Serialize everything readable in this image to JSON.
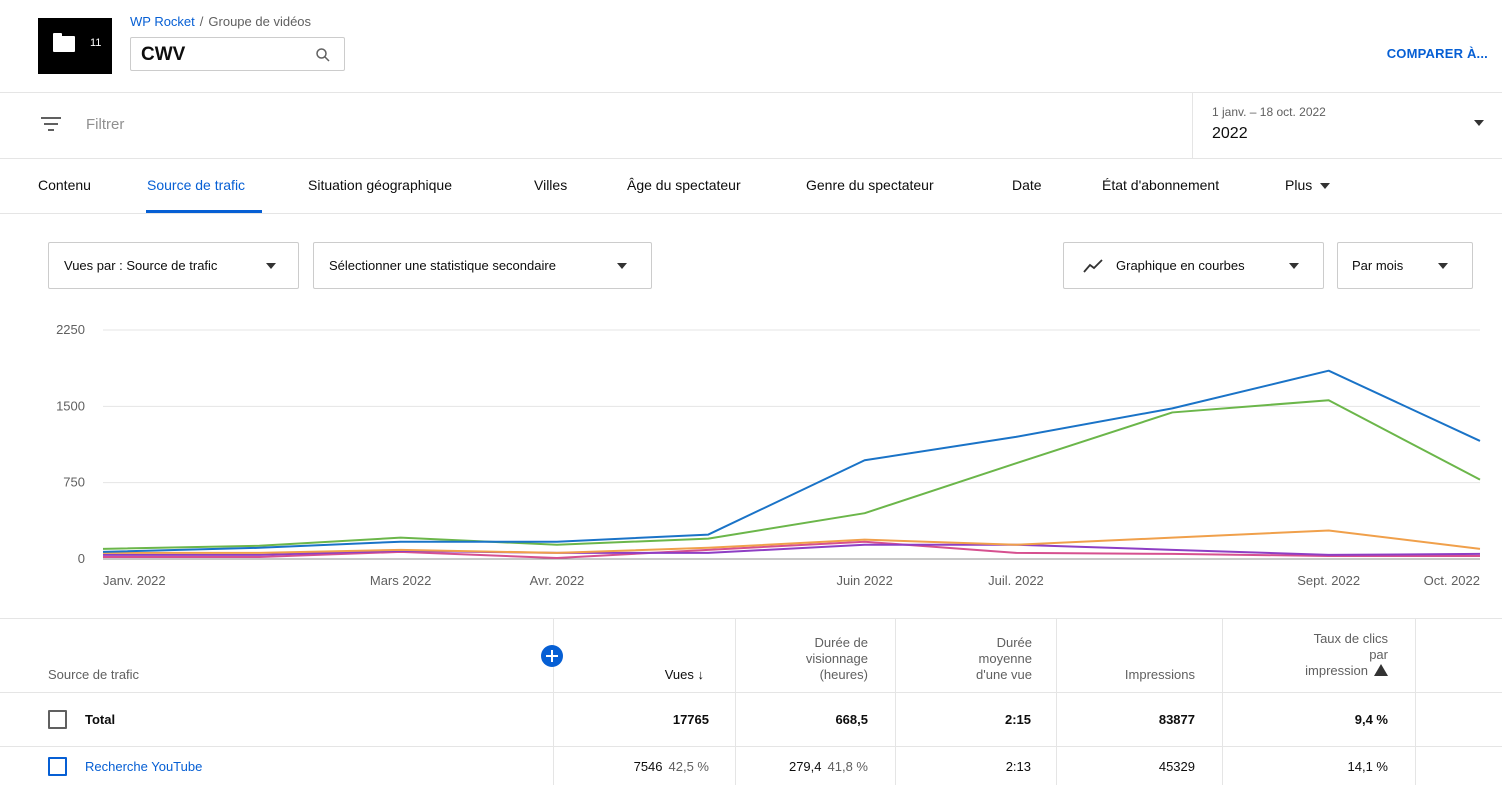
{
  "header": {
    "folder_count": "11",
    "breadcrumb_channel": "WP Rocket",
    "breadcrumb_separator": "/",
    "breadcrumb_section": "Groupe de vidéos",
    "search_value": "CWV",
    "compare_label": "COMPARER À..."
  },
  "filter": {
    "label": "Filtrer",
    "date_range": "1 janv. – 18 oct. 2022",
    "date_year": "2022"
  },
  "tabs": [
    {
      "label": "Contenu"
    },
    {
      "label": "Source de trafic"
    },
    {
      "label": "Situation géographique"
    },
    {
      "label": "Villes"
    },
    {
      "label": "Âge du spectateur"
    },
    {
      "label": "Genre du spectateur"
    },
    {
      "label": "Date"
    },
    {
      "label": "État d'abonnement"
    },
    {
      "label": "Plus"
    }
  ],
  "controls": {
    "views_by": "Vues par : Source de trafic",
    "secondary_stat": "Sélectionner une statistique secondaire",
    "chart_type": "Graphique en courbes",
    "period": "Par mois"
  },
  "chart_data": {
    "type": "line",
    "x": [
      "2022-01-01",
      "2022-02-01",
      "2022-03-01",
      "2022-04-01",
      "2022-05-01",
      "2022-06-01",
      "2022-07-01",
      "2022-08-01",
      "2022-09-01",
      "2022-10-01"
    ],
    "x_tick_labels": [
      {
        "date": "2022-01-01",
        "label": "Janv. 2022"
      },
      {
        "date": "2022-03-01",
        "label": "Mars 2022"
      },
      {
        "date": "2022-04-01",
        "label": "Avr. 2022"
      },
      {
        "date": "2022-06-01",
        "label": "Juin 2022"
      },
      {
        "date": "2022-07-01",
        "label": "Juil. 2022"
      },
      {
        "date": "2022-09-01",
        "label": "Sept. 2022"
      },
      {
        "date": "2022-10-01",
        "label": "Oct. 2022"
      }
    ],
    "y_ticks": [
      {
        "value": 0,
        "label": "0"
      },
      {
        "value": 750,
        "label": "750"
      },
      {
        "value": 1500,
        "label": "1500"
      },
      {
        "value": 2250,
        "label": "2250"
      }
    ],
    "ylim": [
      0,
      2250
    ],
    "grid": true,
    "series": [
      {
        "color": "#1a73c7",
        "values": [
          70,
          110,
          170,
          170,
          240,
          970,
          1200,
          1480,
          1850,
          1160
        ]
      },
      {
        "color": "#6bb64a",
        "values": [
          100,
          130,
          210,
          140,
          200,
          450,
          940,
          1440,
          1560,
          780
        ]
      },
      {
        "color": "#f0a04b",
        "values": [
          60,
          60,
          90,
          60,
          110,
          190,
          140,
          210,
          280,
          100
        ]
      },
      {
        "color": "#8e3ec4",
        "values": [
          40,
          40,
          80,
          60,
          60,
          140,
          140,
          90,
          40,
          50
        ]
      },
      {
        "color": "#d6508f",
        "values": [
          20,
          20,
          70,
          10,
          90,
          170,
          60,
          50,
          30,
          30
        ]
      }
    ]
  },
  "table": {
    "headers": {
      "source": "Source de trafic",
      "views": "Vues",
      "watch_time": [
        "Durée de",
        "visionnage",
        "(heures)"
      ],
      "avg_duration": [
        "Durée",
        "moyenne",
        "d'une vue"
      ],
      "impressions": "Impressions",
      "ctr": [
        "Taux de clics",
        "par",
        "impression"
      ]
    },
    "rows": [
      {
        "name": "Total",
        "views": "17765",
        "views_pct": "",
        "watch": "668,5",
        "watch_pct": "",
        "avg": "2:15",
        "impressions": "83877",
        "ctr": "9,4 %"
      },
      {
        "name": "Recherche YouTube",
        "views": "7546",
        "views_pct": "42,5 %",
        "watch": "279,4",
        "watch_pct": "41,8 %",
        "avg": "2:13",
        "impressions": "45329",
        "ctr": "14,1 %"
      }
    ]
  }
}
